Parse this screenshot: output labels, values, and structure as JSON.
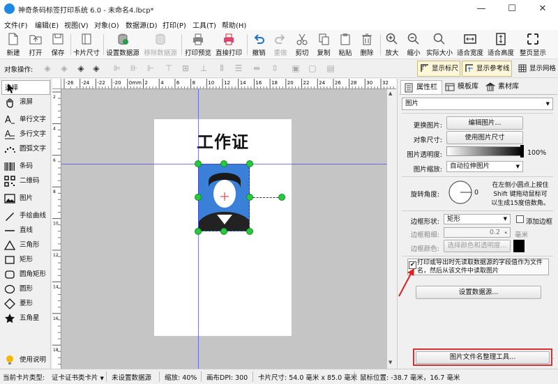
{
  "window": {
    "title": "神奇条码标签打印系统 6.0 - 未命名4.lbcp*",
    "controls": {
      "minimize": "—",
      "maximize": "☐",
      "close": "✕"
    }
  },
  "menu": [
    "文件(F)",
    "编辑(E)",
    "视图(V)",
    "对象(O)",
    "数据源(D)",
    "打印(P)",
    "工具(T)",
    "帮助(H)"
  ],
  "toolbar": {
    "buttons": [
      {
        "label": "新建",
        "icon": "new-doc-icon"
      },
      {
        "label": "打开",
        "icon": "open-icon"
      },
      {
        "label": "保存",
        "icon": "save-icon"
      },
      {
        "label": "卡片尺寸",
        "icon": "card-size-icon"
      },
      {
        "label": "设置数据源",
        "icon": "database-icon"
      },
      {
        "label": "移除数据源",
        "icon": "remove-database-icon",
        "disabled": true
      },
      {
        "label": "打印预览",
        "icon": "print-preview-icon"
      },
      {
        "label": "直接打印",
        "icon": "print-icon"
      },
      {
        "label": "撤销",
        "icon": "undo-icon"
      },
      {
        "label": "重做",
        "icon": "redo-icon",
        "disabled": true
      },
      {
        "label": "剪切",
        "icon": "cut-icon"
      },
      {
        "label": "复制",
        "icon": "copy-icon"
      },
      {
        "label": "粘贴",
        "icon": "paste-icon"
      },
      {
        "label": "删除",
        "icon": "delete-icon"
      },
      {
        "label": "放大",
        "icon": "zoom-in-icon"
      },
      {
        "label": "缩小",
        "icon": "zoom-out-icon"
      },
      {
        "label": "实际大小",
        "icon": "actual-size-icon"
      },
      {
        "label": "适合宽度",
        "icon": "fit-width-icon"
      },
      {
        "label": "适合高度",
        "icon": "fit-height-icon"
      },
      {
        "label": "整页显示",
        "icon": "full-page-icon"
      }
    ]
  },
  "objbar": {
    "label": "对象操作:",
    "toggles": [
      {
        "label": "显示标尺",
        "on": true
      },
      {
        "label": "显示参考线",
        "on": true
      },
      {
        "label": "显示网格",
        "on": false
      }
    ]
  },
  "tools": [
    {
      "label": "选择",
      "icon": "cursor-icon",
      "selected": true
    },
    {
      "label": "滚屏",
      "icon": "hand-icon"
    },
    {
      "label": "单行文字",
      "icon": "single-line-text-icon"
    },
    {
      "label": "多行文字",
      "icon": "multi-line-text-icon"
    },
    {
      "label": "圆弧文字",
      "icon": "arc-text-icon"
    },
    {
      "label": "条码",
      "icon": "barcode-icon"
    },
    {
      "label": "二维码",
      "icon": "qrcode-icon"
    },
    {
      "label": "图片",
      "icon": "image-icon"
    },
    {
      "label": "手绘曲线",
      "icon": "freehand-icon"
    },
    {
      "label": "直线",
      "icon": "line-icon"
    },
    {
      "label": "三角形",
      "icon": "triangle-icon"
    },
    {
      "label": "矩形",
      "icon": "rectangle-icon"
    },
    {
      "label": "圆角矩形",
      "icon": "rounded-rect-icon"
    },
    {
      "label": "圆形",
      "icon": "circle-icon"
    },
    {
      "label": "菱形",
      "icon": "diamond-icon"
    },
    {
      "label": "五角星",
      "icon": "star-icon"
    }
  ],
  "help_label": "使用说明",
  "ruler": {
    "h_ticks": [
      "-26",
      "-24",
      "-22",
      "-20",
      "0mm",
      "2",
      "4",
      "6",
      "8",
      "10",
      "12",
      "14",
      "16",
      "18",
      "20",
      "22",
      "24",
      "26",
      "28",
      "30",
      "32",
      "34",
      "36",
      "38",
      "40",
      "42",
      "44",
      "46",
      "48",
      "50",
      "52",
      "54",
      "56",
      "58",
      "60",
      "62",
      "64",
      "66",
      "68",
      "70",
      "72",
      "74",
      "76",
      "78",
      "80"
    ],
    "v_ticks": [
      "2",
      "4",
      "6",
      "8",
      "10",
      "12",
      "14",
      "16",
      "18",
      "20",
      "22",
      "24",
      "26",
      "28",
      "30",
      "32",
      "34",
      "36",
      "38",
      "40",
      "42",
      "44",
      "46",
      "48",
      "50",
      "52",
      "54",
      "56",
      "58",
      "60",
      "62",
      "64",
      "66",
      "68",
      "70",
      "72",
      "74",
      "76",
      "78",
      "80",
      "82",
      "84"
    ]
  },
  "canvas": {
    "title": "工作证"
  },
  "panel": {
    "tabs": [
      "属性栏",
      "模板库",
      "素材库"
    ],
    "object_type": "图片",
    "change_image_label": "更换图片:",
    "edit_image_btn": "编辑图片...",
    "size_label": "对象尺寸:",
    "use_image_size_btn": "使用图片尺寸",
    "opacity_label": "图片透明度:",
    "opacity_value": "100%",
    "opacity": 1.0,
    "scale_label": "图片缩放:",
    "scale_value": "自动拉伸图片",
    "rotate_label": "旋转角度:",
    "rotate_value": "0",
    "rotate_hint": "在左侧小圆点上按住Shift 键拖动鼠标可以生成15度倍数角。",
    "border_shape_label": "边框形状:",
    "border_shape_value": "矩形",
    "add_border_label": "添加边框",
    "border_width_label": "边框粗细:",
    "border_width_value": "0.2",
    "border_width_unit": "毫米",
    "border_color_label": "边框颜色:",
    "choose_color_btn": "选择颜色和透明度...",
    "border_color": "#000000",
    "read_from_field_label": "打印或导出时先读取数据源的字段值作为文件名，然后从该文件中读取图片",
    "read_from_field_checked": true,
    "set_datasource_btn": "设置数据源...",
    "filename_tool_btn": "图片文件名整理工具..."
  },
  "status": {
    "card_type_label": "当前卡片类型:",
    "card_type": "证卡证书类卡片",
    "datasource": "未设置数据源",
    "zoom": "缩放: 40%",
    "dpi": "画布DPI: 300",
    "card_size": "卡片尺寸: 54.0 毫米 x 85.0 毫米",
    "mouse_pos": "鼠标位置: -38.7 毫米，16.7 毫米"
  },
  "colors": {
    "accent_blue": "#1e88e5",
    "handle_green": "#27c93f",
    "guide_blue": "#4444ee",
    "photo_bg": "#3a80d8",
    "arrow_red": "#e02020",
    "highlight_box": "#d63030"
  }
}
